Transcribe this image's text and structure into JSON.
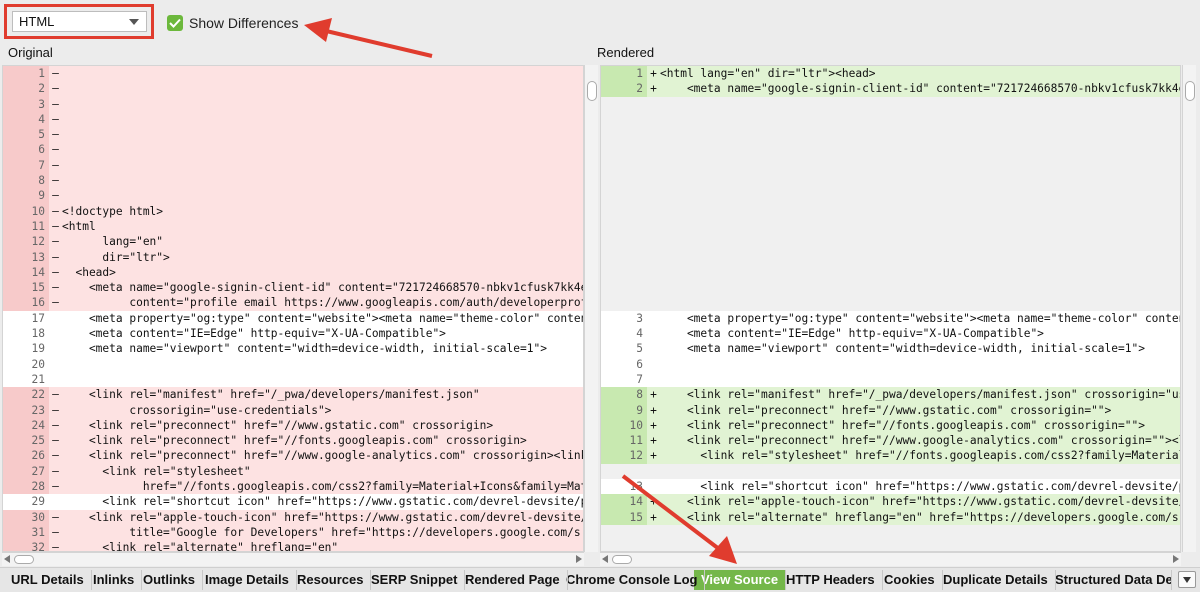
{
  "toolbar": {
    "format_select": "HTML",
    "show_differences_label": "Show Differences",
    "show_differences_checked": true
  },
  "panes": {
    "original_title": "Original",
    "rendered_title": "Rendered"
  },
  "original_lines": [
    {
      "n": "1",
      "t": "del",
      "m": "–",
      "c": ""
    },
    {
      "n": "2",
      "t": "del",
      "m": "–",
      "c": ""
    },
    {
      "n": "3",
      "t": "del",
      "m": "–",
      "c": ""
    },
    {
      "n": "4",
      "t": "del",
      "m": "–",
      "c": ""
    },
    {
      "n": "5",
      "t": "del",
      "m": "–",
      "c": ""
    },
    {
      "n": "6",
      "t": "del",
      "m": "–",
      "c": ""
    },
    {
      "n": "7",
      "t": "del",
      "m": "–",
      "c": ""
    },
    {
      "n": "8",
      "t": "del",
      "m": "–",
      "c": ""
    },
    {
      "n": "9",
      "t": "del",
      "m": "–",
      "c": ""
    },
    {
      "n": "10",
      "t": "del",
      "m": "–",
      "c": "<!doctype html>"
    },
    {
      "n": "11",
      "t": "del",
      "m": "–",
      "c": "<html"
    },
    {
      "n": "12",
      "t": "del",
      "m": "–",
      "c": "      lang=\"en\""
    },
    {
      "n": "13",
      "t": "del",
      "m": "–",
      "c": "      dir=\"ltr\">"
    },
    {
      "n": "14",
      "t": "del",
      "m": "–",
      "c": "  <head>"
    },
    {
      "n": "15",
      "t": "del",
      "m": "–",
      "c": "    <meta name=\"google-signin-client-id\" content=\"721724668570-nbkv1cfusk7kk4en"
    },
    {
      "n": "16",
      "t": "del",
      "m": "–",
      "c": "          content=\"profile email https://www.googleapis.com/auth/developerprofi"
    },
    {
      "n": "17",
      "t": "same",
      "m": "",
      "c": "    <meta property=\"og:type\" content=\"website\"><meta name=\"theme-color\" content"
    },
    {
      "n": "18",
      "t": "same",
      "m": "",
      "c": "    <meta content=\"IE=Edge\" http-equiv=\"X-UA-Compatible\">"
    },
    {
      "n": "19",
      "t": "same",
      "m": "",
      "c": "    <meta name=\"viewport\" content=\"width=device-width, initial-scale=1\">"
    },
    {
      "n": "20",
      "t": "same",
      "m": "",
      "c": ""
    },
    {
      "n": "21",
      "t": "same",
      "m": "",
      "c": ""
    },
    {
      "n": "22",
      "t": "del",
      "m": "–",
      "c": "    <link rel=\"manifest\" href=\"/_pwa/developers/manifest.json\""
    },
    {
      "n": "23",
      "t": "del",
      "m": "–",
      "c": "          crossorigin=\"use-credentials\">"
    },
    {
      "n": "24",
      "t": "del",
      "m": "–",
      "c": "    <link rel=\"preconnect\" href=\"//www.gstatic.com\" crossorigin>"
    },
    {
      "n": "25",
      "t": "del",
      "m": "–",
      "c": "    <link rel=\"preconnect\" href=\"//fonts.googleapis.com\" crossorigin>"
    },
    {
      "n": "26",
      "t": "del",
      "m": "–",
      "c": "    <link rel=\"preconnect\" href=\"//www.google-analytics.com\" crossorigin><link"
    },
    {
      "n": "27",
      "t": "del",
      "m": "–",
      "c": "      <link rel=\"stylesheet\""
    },
    {
      "n": "28",
      "t": "del",
      "m": "–",
      "c": "            href=\"//fonts.googleapis.com/css2?family=Material+Icons&family=Mate"
    },
    {
      "n": "29",
      "t": "same",
      "m": "",
      "c": "      <link rel=\"shortcut icon\" href=\"https://www.gstatic.com/devrel-devsite/pr"
    },
    {
      "n": "30",
      "t": "del",
      "m": "–",
      "c": "    <link rel=\"apple-touch-icon\" href=\"https://www.gstatic.com/devrel-devsite/p"
    },
    {
      "n": "31",
      "t": "del",
      "m": "–",
      "c": "          title=\"Google for Developers\" href=\"https://developers.google.com/s"
    },
    {
      "n": "32",
      "t": "del",
      "m": "–",
      "c": "      <link rel=\"alternate\" hreflang=\"en\""
    }
  ],
  "rendered_lines": [
    {
      "n": "1",
      "t": "add",
      "m": "+",
      "c": "<html lang=\"en\" dir=\"ltr\"><head>"
    },
    {
      "n": "2",
      "t": "add",
      "m": "+",
      "c": "    <meta name=\"google-signin-client-id\" content=\"721724668570-nbkv1cfusk7kk4en"
    },
    {
      "n": "",
      "t": "empty",
      "m": "",
      "c": ""
    },
    {
      "n": "",
      "t": "empty",
      "m": "",
      "c": ""
    },
    {
      "n": "",
      "t": "empty",
      "m": "",
      "c": ""
    },
    {
      "n": "",
      "t": "empty",
      "m": "",
      "c": ""
    },
    {
      "n": "",
      "t": "empty",
      "m": "",
      "c": ""
    },
    {
      "n": "",
      "t": "empty",
      "m": "",
      "c": ""
    },
    {
      "n": "",
      "t": "empty",
      "m": "",
      "c": ""
    },
    {
      "n": "",
      "t": "empty",
      "m": "",
      "c": ""
    },
    {
      "n": "",
      "t": "empty",
      "m": "",
      "c": ""
    },
    {
      "n": "",
      "t": "empty",
      "m": "",
      "c": ""
    },
    {
      "n": "",
      "t": "empty",
      "m": "",
      "c": ""
    },
    {
      "n": "",
      "t": "empty",
      "m": "",
      "c": ""
    },
    {
      "n": "",
      "t": "empty",
      "m": "",
      "c": ""
    },
    {
      "n": "",
      "t": "empty",
      "m": "",
      "c": ""
    },
    {
      "n": "3",
      "t": "same",
      "m": "",
      "c": "    <meta property=\"og:type\" content=\"website\"><meta name=\"theme-color\" content"
    },
    {
      "n": "4",
      "t": "same",
      "m": "",
      "c": "    <meta content=\"IE=Edge\" http-equiv=\"X-UA-Compatible\">"
    },
    {
      "n": "5",
      "t": "same",
      "m": "",
      "c": "    <meta name=\"viewport\" content=\"width=device-width, initial-scale=1\">"
    },
    {
      "n": "6",
      "t": "same",
      "m": "",
      "c": ""
    },
    {
      "n": "7",
      "t": "same",
      "m": "",
      "c": ""
    },
    {
      "n": "8",
      "t": "add",
      "m": "+",
      "c": "    <link rel=\"manifest\" href=\"/_pwa/developers/manifest.json\" crossorigin=\"use"
    },
    {
      "n": "9",
      "t": "add",
      "m": "+",
      "c": "    <link rel=\"preconnect\" href=\"//www.gstatic.com\" crossorigin=\"\">"
    },
    {
      "n": "10",
      "t": "add",
      "m": "+",
      "c": "    <link rel=\"preconnect\" href=\"//fonts.googleapis.com\" crossorigin=\"\">"
    },
    {
      "n": "11",
      "t": "add",
      "m": "+",
      "c": "    <link rel=\"preconnect\" href=\"//www.google-analytics.com\" crossorigin=\"\"><li"
    },
    {
      "n": "12",
      "t": "add",
      "m": "+",
      "c": "      <link rel=\"stylesheet\" href=\"//fonts.googleapis.com/css2?family=Material+"
    },
    {
      "n": "",
      "t": "empty",
      "m": "",
      "c": ""
    },
    {
      "n": "13",
      "t": "same",
      "m": "",
      "c": "      <link rel=\"shortcut icon\" href=\"https://www.gstatic.com/devrel-devsite/pr"
    },
    {
      "n": "14",
      "t": "add",
      "m": "+",
      "c": "    <link rel=\"apple-touch-icon\" href=\"https://www.gstatic.com/devrel-devsite/p"
    },
    {
      "n": "15",
      "t": "add",
      "m": "+",
      "c": "    <link rel=\"alternate\" hreflang=\"en\" href=\"https://developers.google.com/s"
    },
    {
      "n": "",
      "t": "empty",
      "m": "",
      "c": ""
    },
    {
      "n": "",
      "t": "empty",
      "m": "",
      "c": ""
    }
  ],
  "tabs": [
    {
      "label": "URL Details",
      "active": false
    },
    {
      "label": "Inlinks",
      "active": false
    },
    {
      "label": "Outlinks",
      "active": false
    },
    {
      "label": "Image Details",
      "active": false
    },
    {
      "label": "Resources",
      "active": false
    },
    {
      "label": "SERP Snippet",
      "active": false
    },
    {
      "label": "Rendered Page",
      "active": false
    },
    {
      "label": "Chrome Console Log",
      "active": false
    },
    {
      "label": "View Source",
      "active": true
    },
    {
      "label": "HTTP Headers",
      "active": false
    },
    {
      "label": "Cookies",
      "active": false
    },
    {
      "label": "Duplicate Details",
      "active": false
    },
    {
      "label": "Structured Data Deta",
      "active": false
    }
  ],
  "colors": {
    "annotation_red": "#e03c2e",
    "active_tab": "#74b74a",
    "deleted_row": "#fde2e2",
    "added_row": "#e1f3d3"
  }
}
